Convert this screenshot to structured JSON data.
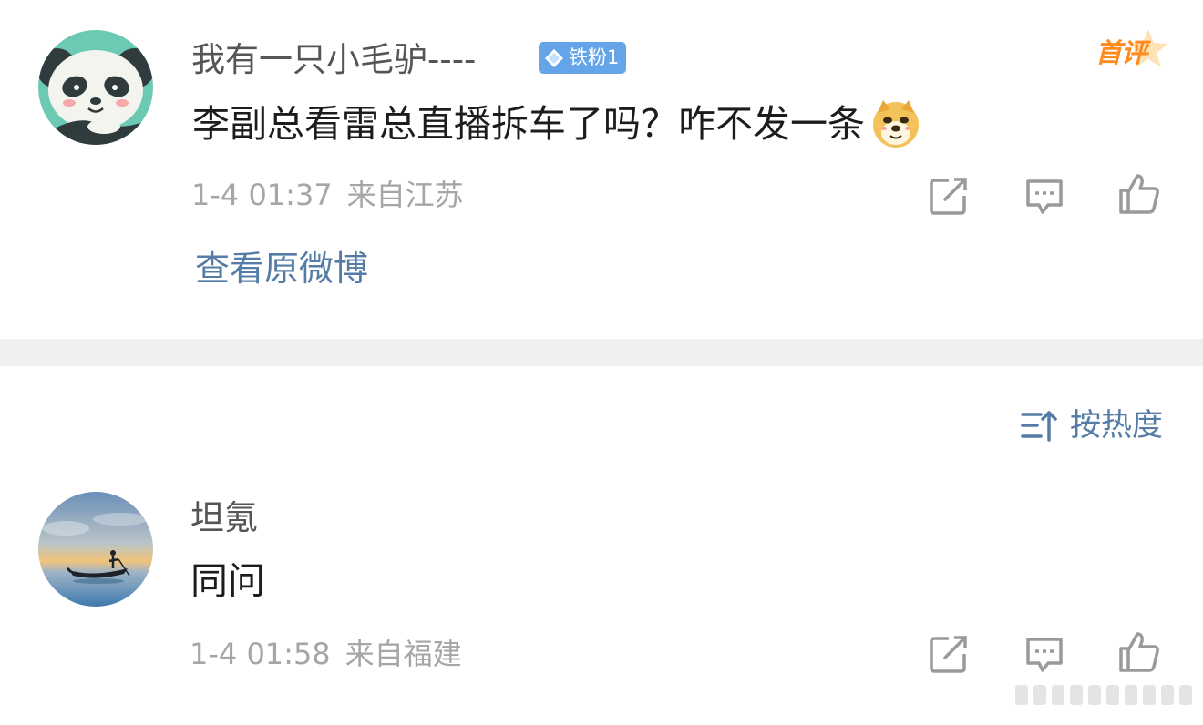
{
  "main_comment": {
    "username": "我有一只小毛驴----",
    "fan_badge": "铁粉1",
    "first_comment_badge": "首评",
    "text": "李副总看雷总直播拆车了吗？咋不发一条",
    "time": "1-4 01:37",
    "location": "来自江苏",
    "view_original_label": "查看原微博"
  },
  "sort": {
    "label": "按热度"
  },
  "reply": {
    "username": "坦氪",
    "text": "同问",
    "time": "1-4 01:58",
    "location": "来自福建"
  },
  "colors": {
    "link_blue": "#557ca6",
    "badge_blue": "#63a5e8",
    "first_badge_orange": "#ff8a1e",
    "meta_gray": "#a6a6a6",
    "separator_gray": "#f0f0f0"
  },
  "icons": [
    "panda-avatar",
    "diamond-icon",
    "doge-emoji",
    "share-icon",
    "comment-icon",
    "like-icon",
    "sort-icon",
    "sunset-boat-avatar"
  ]
}
